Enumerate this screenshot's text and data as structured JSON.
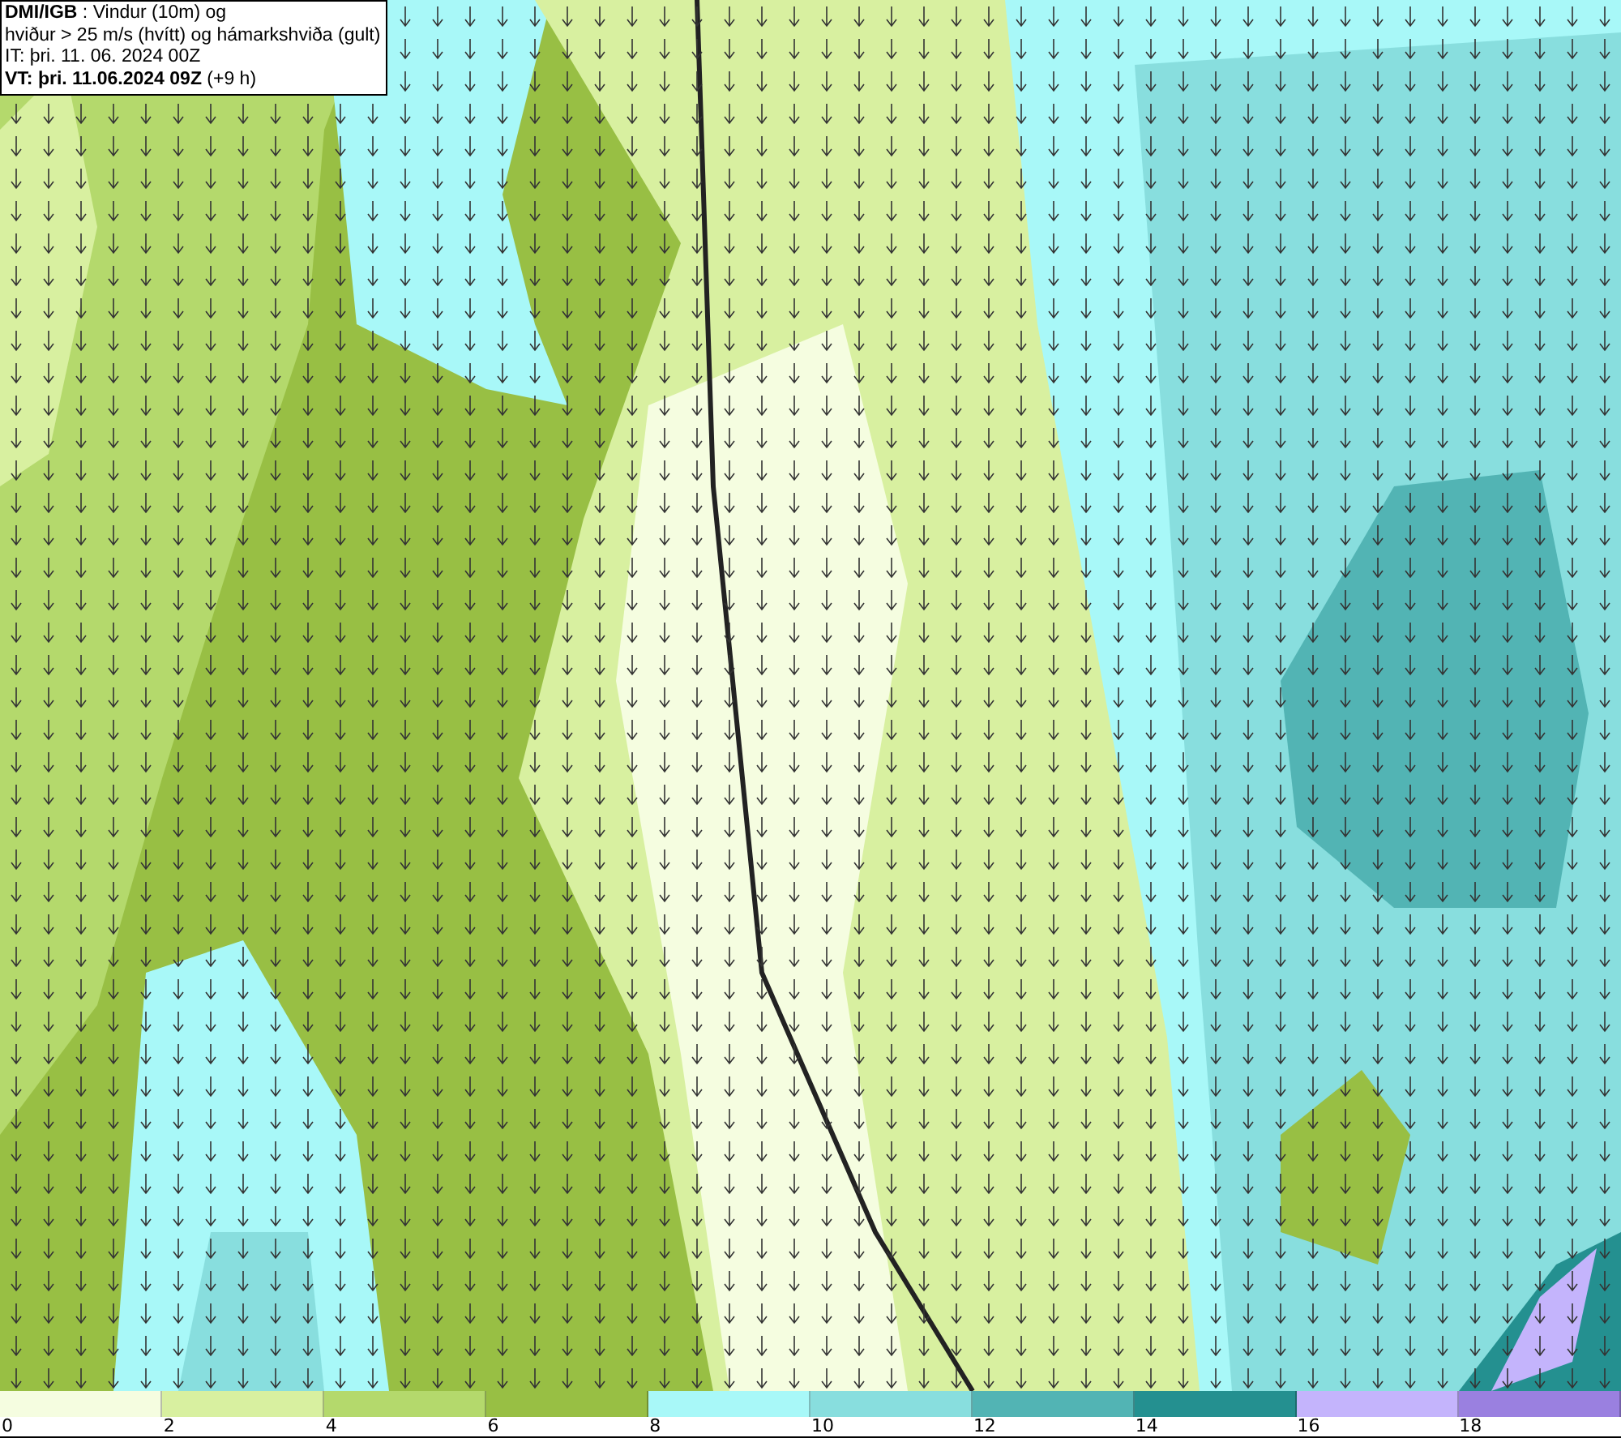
{
  "header": {
    "lines": [
      "**DMI/IGB** : Vindur (10m) og",
      "hviður > 25 m/s (hvítt) og hámarkshviða (gult)",
      "IT: þri. 11. 06. 2024 00Z",
      "**VT: þri. 11.06.2024 09Z** (+9 h)"
    ]
  },
  "legend": {
    "bins": [
      {
        "label": "0",
        "color": "#f5fde0"
      },
      {
        "label": "2",
        "color": "#d8f0a0"
      },
      {
        "label": "4",
        "color": "#b4d96c"
      },
      {
        "label": "6",
        "color": "#98bf44"
      },
      {
        "label": "8",
        "color": "#a8f8f8"
      },
      {
        "label": "10",
        "color": "#88dede"
      },
      {
        "label": "12",
        "color": "#52b4b4"
      },
      {
        "label": "14",
        "color": "#249090"
      },
      {
        "label": "16",
        "color": "#c4b4fc"
      },
      {
        "label": "18",
        "color": "#9a80e0"
      }
    ]
  }
}
